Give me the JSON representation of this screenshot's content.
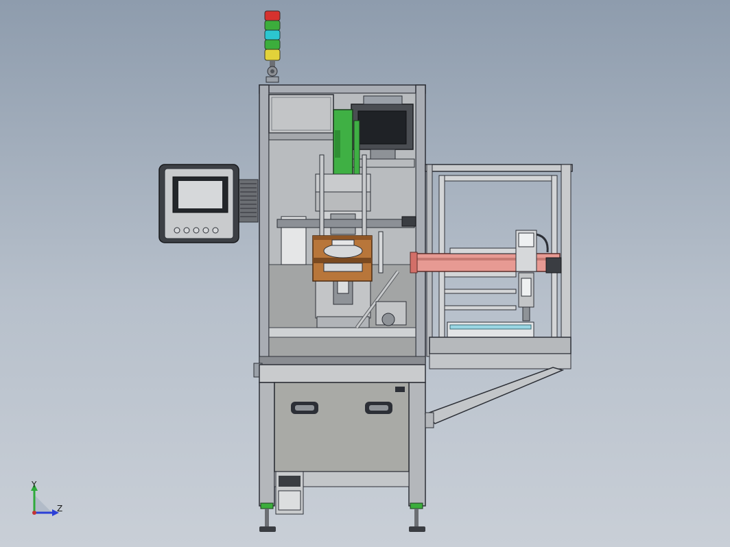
{
  "triad": {
    "y_label": "Y",
    "z_label": "Z"
  },
  "colors": {
    "background_top": "#8e9cad",
    "frame": "#9aa0a8",
    "frame_dark": "#2c2f36",
    "panel_gray": "#a9aaa6",
    "press_green": "#3fb044",
    "fixture_copper": "#b8763a",
    "slide_pink": "#e79a93",
    "tower_red": "#d6322e",
    "tower_green": "#3cad3c",
    "tower_cyan": "#2cc6d0",
    "tower_yellow": "#e2d23a",
    "axis_y": "#2eaa3a",
    "axis_z": "#2b3fd6",
    "axis_origin": "#c23434"
  },
  "components": [
    "signal-tower",
    "main-frame",
    "electrical-box",
    "top-monitor",
    "hmi-panel",
    "press-column",
    "fixture-block",
    "side-conveyor-frame",
    "linear-slide",
    "gripper-module",
    "cabinet",
    "drawer-handles",
    "leveling-feet",
    "support-brace",
    "axis-triad"
  ]
}
